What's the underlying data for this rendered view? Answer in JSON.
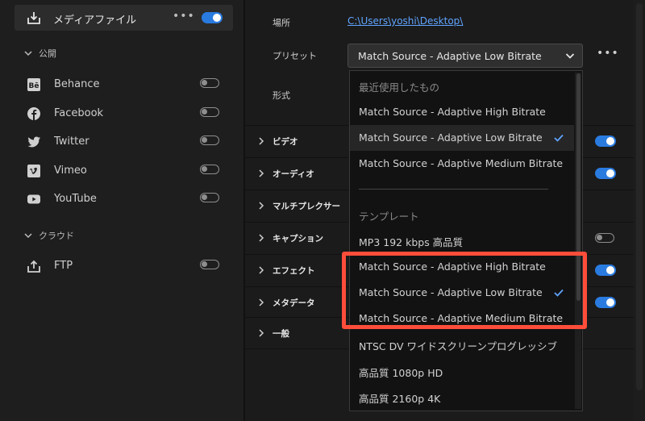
{
  "left": {
    "media": {
      "label": "メディアファイル",
      "more": "•••",
      "enabled": true
    },
    "publish_header": "公開",
    "destinations": [
      {
        "name": "Behance",
        "icon": "behance-icon",
        "enabled": false
      },
      {
        "name": "Facebook",
        "icon": "facebook-icon",
        "enabled": false
      },
      {
        "name": "Twitter",
        "icon": "twitter-icon",
        "enabled": false
      },
      {
        "name": "Vimeo",
        "icon": "vimeo-icon",
        "enabled": false
      },
      {
        "name": "YouTube",
        "icon": "youtube-icon",
        "enabled": false
      }
    ],
    "cloud_header": "クラウド",
    "cloud": [
      {
        "name": "FTP",
        "icon": "upload-icon",
        "enabled": false
      }
    ]
  },
  "main": {
    "location_label": "場所",
    "location_value": "C:\\Users\\yoshi\\Desktop\\",
    "preset_label": "プリセット",
    "preset_value": "Match Source - Adaptive Low Bitrate",
    "preset_more": "•••",
    "format_label": "形式",
    "sections": [
      {
        "label": "ビデオ",
        "enabled": true
      },
      {
        "label": "オーディオ",
        "enabled": true
      },
      {
        "label": "マルチプレクサー",
        "enabled": null
      },
      {
        "label": "キャプション",
        "enabled": false
      },
      {
        "label": "エフェクト",
        "enabled": true
      },
      {
        "label": "メタデータ",
        "enabled": true
      },
      {
        "label": "一般",
        "enabled": null
      }
    ]
  },
  "dropdown": {
    "recent_header": "最近使用したもの",
    "recent": [
      "Match Source - Adaptive High Bitrate",
      "Match Source - Adaptive Low Bitrate",
      "Match Source - Adaptive Medium Bitrate"
    ],
    "recent_selected": 1,
    "template_header": "テンプレート",
    "templates": [
      "MP3 192 kbps 高品質",
      "Match Source - Adaptive High Bitrate",
      "Match Source - Adaptive Low Bitrate",
      "Match Source - Adaptive Medium Bitrate",
      "NTSC DV ワイドスクリーンプログレッシブ",
      "高品質 1080p HD",
      "高品質 2160p 4K"
    ],
    "template_selected": 2
  },
  "colors": {
    "accent": "#2a7be0",
    "highlight": "#ff4d3a",
    "link": "#5fa4ff"
  }
}
